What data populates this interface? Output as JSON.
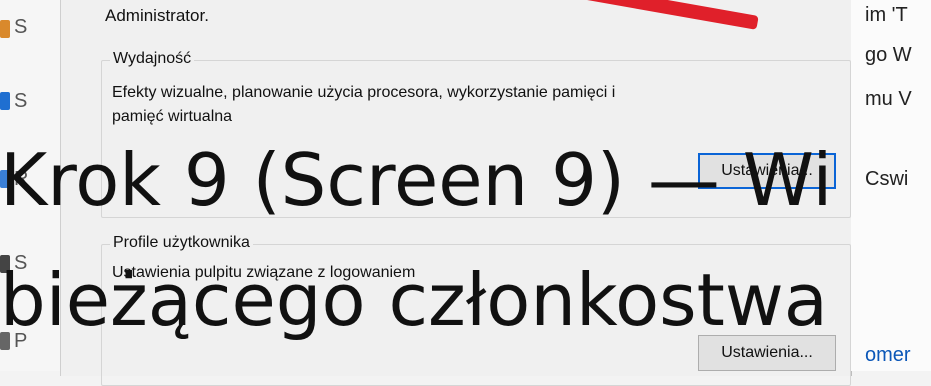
{
  "left_strip": {
    "items": [
      "S",
      "S",
      "R",
      "S",
      "P"
    ]
  },
  "dialog": {
    "intro_line2": "Administrator.",
    "performance": {
      "legend": "Wydajność",
      "description_line1": "Efekty wizualne, planowanie użycia procesora, wykorzystanie pamięci i",
      "description_line2": "pamięć wirtualna",
      "button_label": "Ustawienia..."
    },
    "user_profiles": {
      "legend": "Profile użytkownika",
      "description": "Ustawienia pulpitu związane z logowaniem",
      "button_label": "Ustawienia..."
    }
  },
  "right_strip": {
    "lines": [
      "im 'T",
      "go W",
      "mu V",
      "Cswi",
      "omer"
    ]
  },
  "overlay": {
    "line1": "Krok 9 (Screen 9) — Wi",
    "line2": "bieżącego członkostwa"
  },
  "colors": {
    "dialog_bg": "#f0f0f0",
    "focus_border": "#0a64d6",
    "annotation_red": "#e0202a",
    "link_blue": "#0b57b8"
  }
}
